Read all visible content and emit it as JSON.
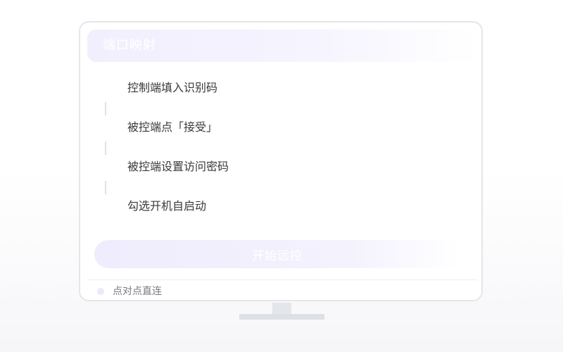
{
  "header": {
    "title": "端口映射"
  },
  "steps": [
    {
      "label": "控制端填入识别码"
    },
    {
      "label": "被控端点「接受」"
    },
    {
      "label": "被控端设置访问密码"
    },
    {
      "label": "勾选开机自启动"
    }
  ],
  "actions": {
    "start_label": "开始远控"
  },
  "footer": {
    "label": "点对点直连"
  },
  "colors": {
    "accent_light": "#efecfd",
    "border": "#e6e6ea",
    "text": "#3a3a3a",
    "muted_text": "#7a7a85",
    "stand": "#e3e6ea"
  }
}
